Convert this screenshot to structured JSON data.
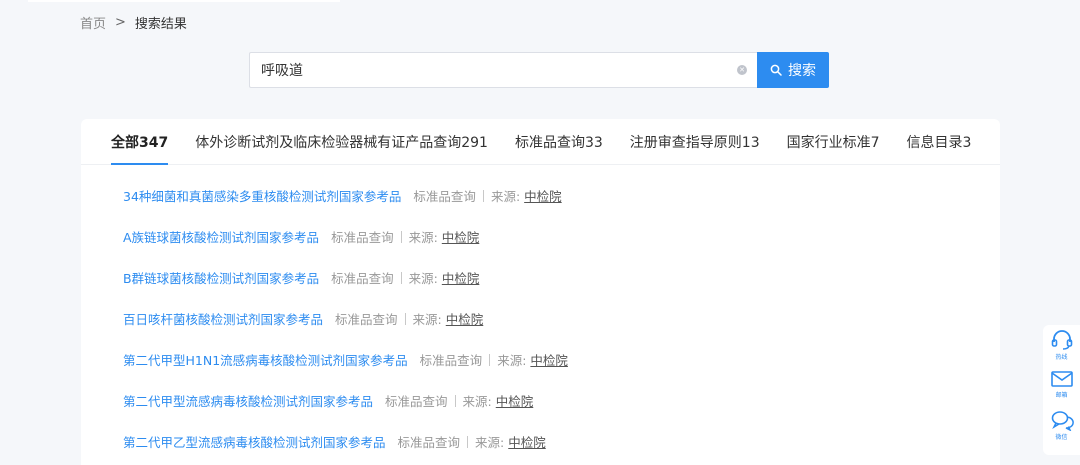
{
  "breadcrumb": {
    "home": "首页",
    "separator": ">",
    "current": "搜索结果"
  },
  "search": {
    "value": "呼吸道",
    "button_label": "搜索",
    "clear_icon": "clear-icon",
    "button_icon": "search-icon"
  },
  "tabs": [
    {
      "label": "全部347",
      "active": true
    },
    {
      "label": "体外诊断试剂及临床检验器械有证产品查询291",
      "active": false
    },
    {
      "label": "标准品查询33",
      "active": false
    },
    {
      "label": "注册审查指导原则13",
      "active": false
    },
    {
      "label": "国家行业标准7",
      "active": false
    },
    {
      "label": "信息目录3",
      "active": false
    }
  ],
  "results": [
    {
      "title": "34种细菌和真菌感染多重核酸检测试剂国家参考品",
      "category": "标准品查询",
      "source_label": "来源:",
      "source": "中检院"
    },
    {
      "title": "A族链球菌核酸检测试剂国家参考品",
      "category": "标准品查询",
      "source_label": "来源:",
      "source": "中检院"
    },
    {
      "title": "B群链球菌核酸检测试剂国家参考品",
      "category": "标准品查询",
      "source_label": "来源:",
      "source": "中检院"
    },
    {
      "title": "百日咳杆菌核酸检测试剂国家参考品",
      "category": "标准品查询",
      "source_label": "来源:",
      "source": "中检院"
    },
    {
      "title": "第二代甲型H1N1流感病毒核酸检测试剂国家参考品",
      "category": "标准品查询",
      "source_label": "来源:",
      "source": "中检院"
    },
    {
      "title": "第二代甲型流感病毒核酸检测试剂国家参考品",
      "category": "标准品查询",
      "source_label": "来源:",
      "source": "中检院"
    },
    {
      "title": "第二代甲乙型流感病毒核酸检测试剂国家参考品",
      "category": "标准品查询",
      "source_label": "来源:",
      "source": "中检院"
    }
  ],
  "sidebar": {
    "hotline": {
      "label": "热线",
      "icon": "headset-icon"
    },
    "email": {
      "label": "邮箱",
      "icon": "mail-icon"
    },
    "wechat": {
      "label": "微信",
      "icon": "chat-bubbles-icon"
    }
  },
  "colors": {
    "accent": "#2d8cf0",
    "background": "#f5f7fa",
    "muted": "#999999"
  }
}
